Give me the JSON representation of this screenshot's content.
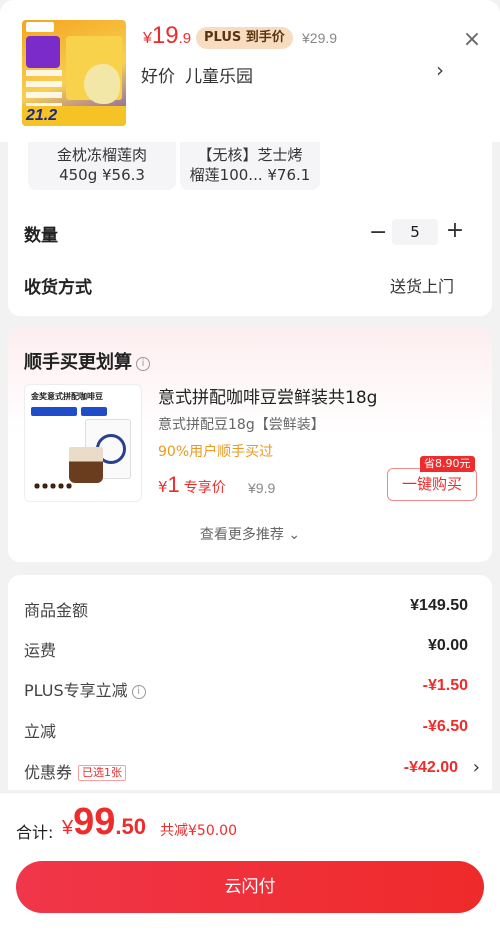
{
  "header": {
    "price_currency": "¥",
    "price_int": "19",
    "price_dec": ".9",
    "plus_badge": "PLUS 到手价",
    "original_price": "¥29.9",
    "subtitle_parts": [
      "好价",
      "儿童乐园"
    ],
    "close_icon": "close-icon",
    "arrow_icon": "chevron-right-icon",
    "thumb_price": "21.2"
  },
  "variants": [
    {
      "line1": "金枕冻榴莲肉",
      "line2": "450g ¥56.3"
    },
    {
      "line1": "【无核】芝士烤",
      "line2": "榴莲100... ¥76.1"
    }
  ],
  "quantity": {
    "label": "数量",
    "minus": "−",
    "value": "5",
    "plus": "+"
  },
  "shipping": {
    "label": "收货方式",
    "value": "送货上门"
  },
  "recommend": {
    "title": "顺手买更划算",
    "info_icon": "i",
    "product_name": "意式拼配咖啡豆尝鲜装共18g",
    "spec": "意式拼配豆18g【尝鲜装】",
    "percent_text": "90%用户顺手买过",
    "price_currency": "¥",
    "price_int": "1",
    "price_tag": "专享价",
    "original_price": "¥9.9",
    "save_badge": "省8.90元",
    "buy_button": "一键购买",
    "more_text": "查看更多推荐 ⌄",
    "img_label": "金奖意式拼配咖啡豆"
  },
  "summary": {
    "rows": [
      {
        "label": "商品金额",
        "value": "¥149.50",
        "red": false
      },
      {
        "label": "运费",
        "value": "¥0.00",
        "red": false
      },
      {
        "label": "PLUS专享立减",
        "value": "-¥1.50",
        "red": true
      },
      {
        "label": "立减",
        "value": "-¥6.50",
        "red": true
      },
      {
        "label": "优惠券",
        "value": "-¥42.00",
        "red": true
      }
    ],
    "coupon_badge": "已选1张"
  },
  "bottom": {
    "total_label": "合计:",
    "total_currency": "¥",
    "total_int": "99",
    "total_dec": ".50",
    "discount": "共减¥50.00",
    "pay_button": "云闪付"
  },
  "colors": {
    "accent_red": "#ee2c2c",
    "plus_badge_bg": "#f8dcc0",
    "promo_orange": "#e89a21"
  }
}
